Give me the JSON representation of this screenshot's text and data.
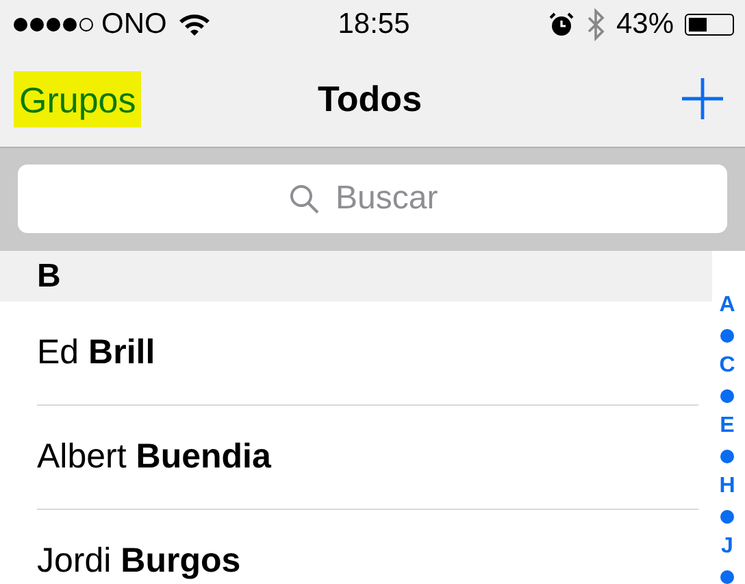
{
  "status_bar": {
    "signal": [
      {
        "on": true
      },
      {
        "on": true
      },
      {
        "on": true
      },
      {
        "on": true
      },
      {
        "on": false
      }
    ],
    "carrier": "ONO",
    "time": "18:55",
    "battery": "43%"
  },
  "nav_bar": {
    "back": "Grupos",
    "title": "Todos"
  },
  "search": {
    "placeholder": "Buscar"
  },
  "section": {
    "header": "B",
    "contacts": [
      {
        "first": "Ed",
        "last": "Brill"
      },
      {
        "first": "Albert",
        "last": "Buendia"
      },
      {
        "first": "Jordi",
        "last": "Burgos"
      }
    ]
  },
  "index": [
    {
      "kind": "letter",
      "text": "A"
    },
    {
      "kind": "dot"
    },
    {
      "kind": "letter",
      "text": "C"
    },
    {
      "kind": "dot"
    },
    {
      "kind": "letter",
      "text": "E"
    },
    {
      "kind": "dot"
    },
    {
      "kind": "letter",
      "text": "H"
    },
    {
      "kind": "dot"
    },
    {
      "kind": "letter",
      "text": "J"
    },
    {
      "kind": "dot"
    }
  ]
}
